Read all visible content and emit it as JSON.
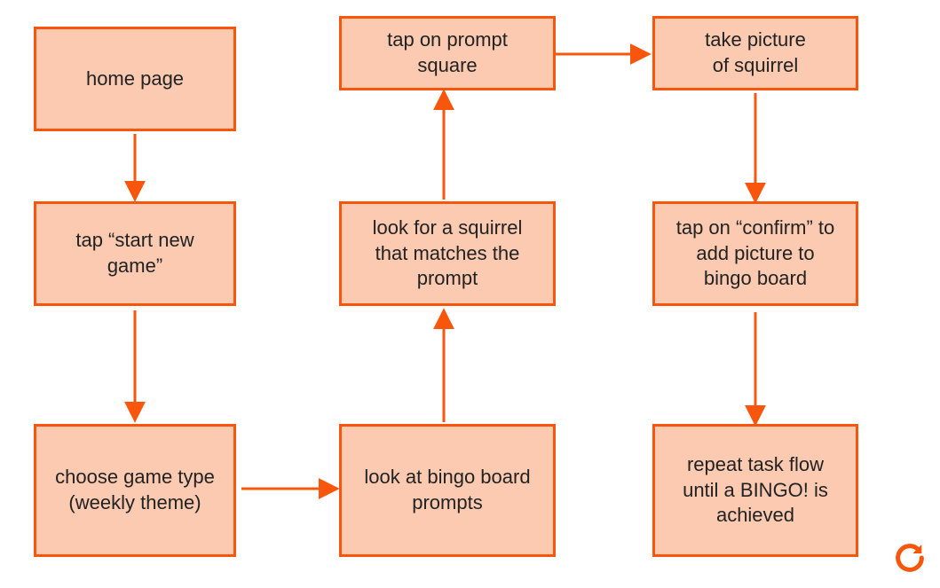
{
  "boxes": {
    "home_page": "home page",
    "start_new_game": "tap “start new game”",
    "choose_type": "choose game type (weekly theme)",
    "look_board": "look at bingo board prompts",
    "look_squirrel": "look for a squirrel that matches the prompt",
    "tap_prompt": "tap on prompt square",
    "take_picture": "take picture of squirrel",
    "tap_confirm": "tap on “confirm” to add picture to bingo board",
    "repeat": "repeat task flow until a BINGO! is achieved"
  },
  "icons": {
    "reload": "reload-icon"
  },
  "colors": {
    "stroke": "#f7560c",
    "fill": "#fccab1"
  }
}
